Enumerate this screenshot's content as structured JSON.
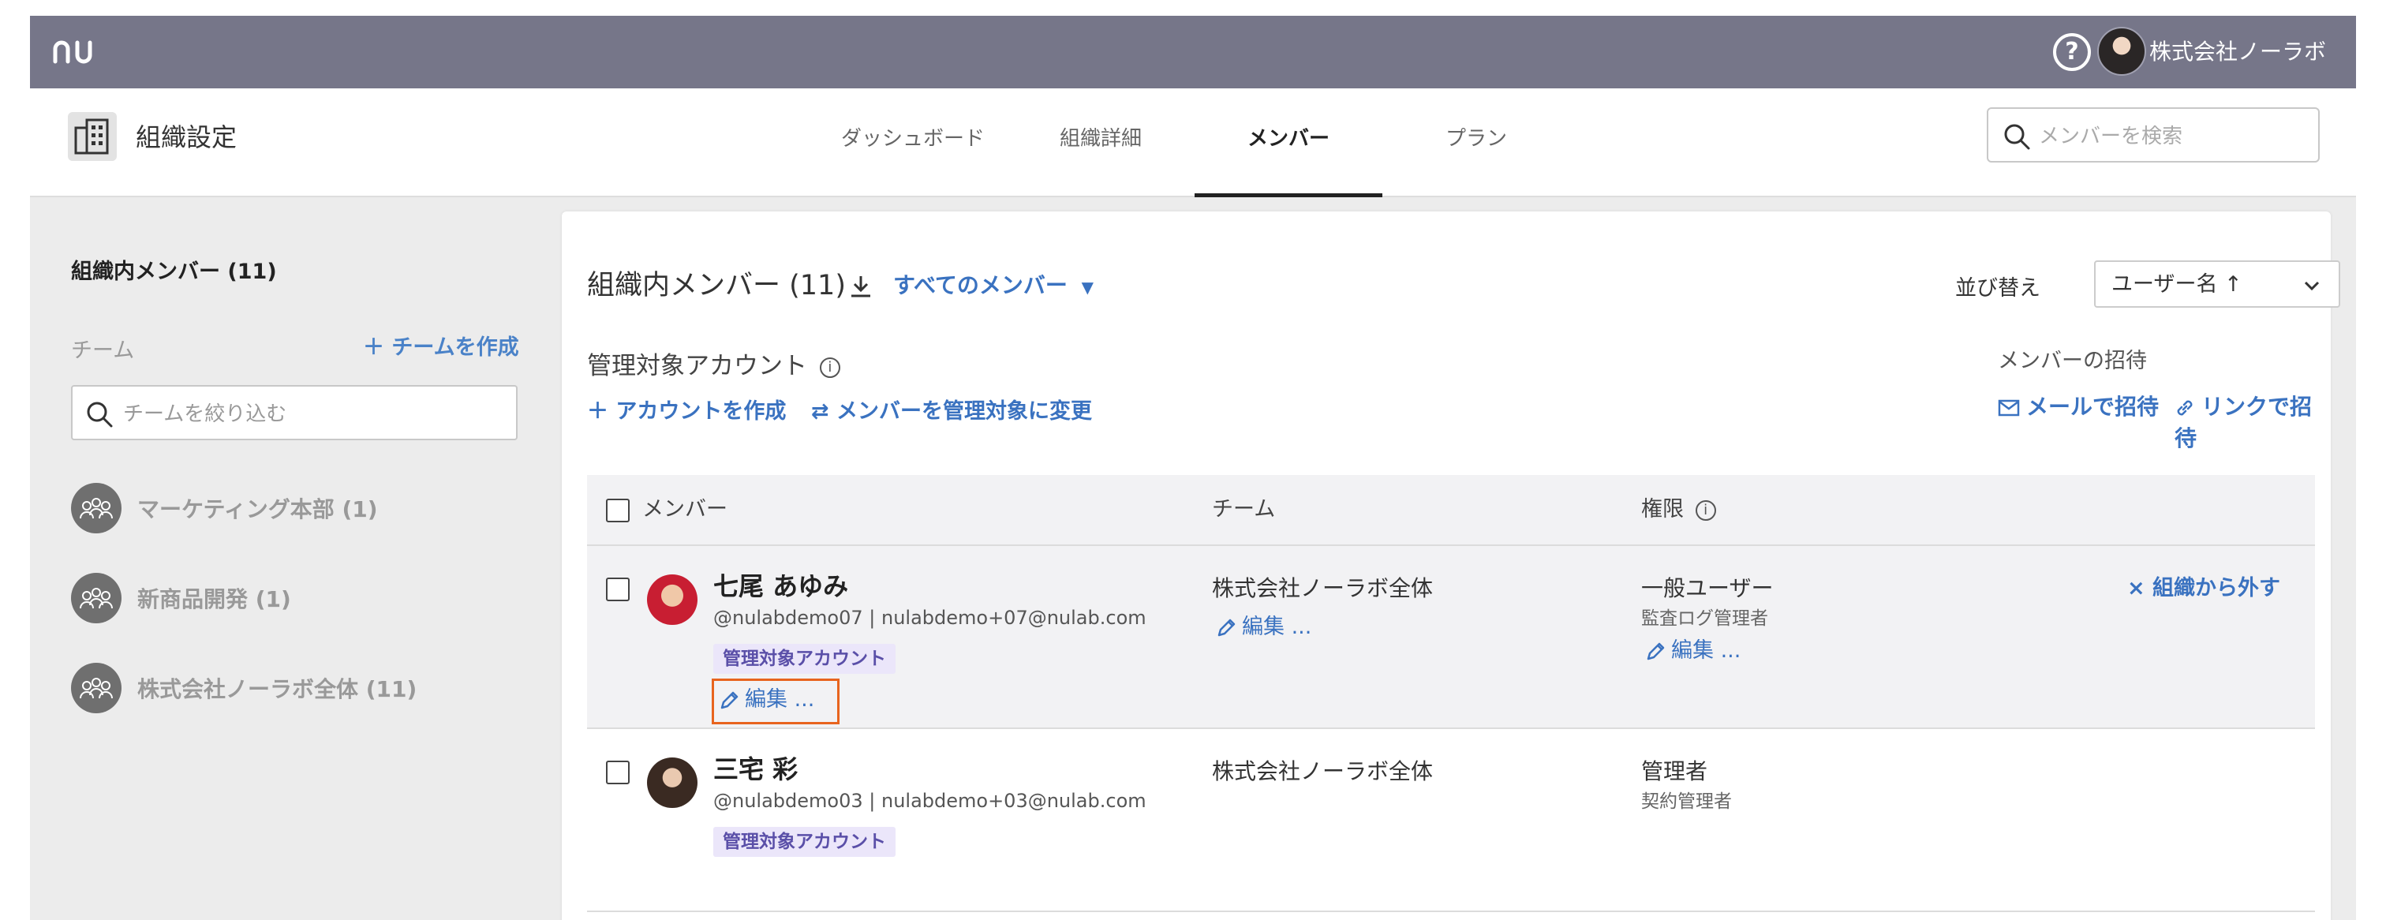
{
  "topbar": {
    "org_name": "株式会社ノーラボ"
  },
  "header": {
    "title": "組織設定",
    "tabs": [
      {
        "label": "ダッシュボード",
        "active": false
      },
      {
        "label": "組織詳細",
        "active": false
      },
      {
        "label": "メンバー",
        "active": true
      },
      {
        "label": "プラン",
        "active": false
      }
    ],
    "search_placeholder": "メンバーを検索"
  },
  "sidebar": {
    "title": "組織内メンバー (11)",
    "team_label": "チーム",
    "create_team_label": "＋ チームを作成",
    "filter_placeholder": "チームを絞り込む",
    "teams": [
      {
        "label": "マーケティング本部 (1)"
      },
      {
        "label": "新商品開発 (1)"
      },
      {
        "label": "株式会社ノーラボ全体 (11)"
      }
    ]
  },
  "main": {
    "title": "組織内メンバー (11)",
    "filter_label": "すべてのメンバー",
    "sort_label": "並び替え",
    "sort_value": "ユーザー名 ↑",
    "managed_label": "管理対象アカウント",
    "create_account_label": "＋ アカウントを作成",
    "change_managed_label": "⇄ メンバーを管理対象に変更",
    "invite_label": "メンバーの招待",
    "invite_mail_label": "メールで招待",
    "invite_link_label": "リンクで招待"
  },
  "table": {
    "headers": {
      "member": "メンバー",
      "team": "チーム",
      "role": "権限"
    },
    "rows": [
      {
        "name": "七尾 あゆみ",
        "handle": "@nulabdemo07 | nulabdemo+07@nulab.com",
        "badge": "管理対象アカウント",
        "edit_label": "編集 ...",
        "team": "株式会社ノーラボ全体",
        "team_edit_label": "編集 ...",
        "role": "一般ユーザー",
        "role_sub": "監査ログ管理者",
        "role_edit_label": "編集 ...",
        "remove_label": "× 組織から外す"
      },
      {
        "name": "三宅 彩",
        "handle": "@nulabdemo03 | nulabdemo+03@nulab.com",
        "badge": "管理対象アカウント",
        "team": "株式会社ノーラボ全体",
        "role": "管理者",
        "role_sub": "契約管理者"
      }
    ]
  },
  "colors": {
    "topbar": "#767689",
    "link": "#3a72c0",
    "badge_bg": "#ebe6fa",
    "badge_text": "#5a4fa8",
    "highlight": "#e8641e"
  },
  "icons": [
    "nulab-logo-icon",
    "help-icon",
    "org-building-icon",
    "search-icon",
    "download-icon",
    "caret-down-icon",
    "chevron-down-icon",
    "info-icon",
    "plus-icon",
    "swap-icon",
    "mail-icon",
    "link-icon",
    "team-people-icon",
    "pencil-icon",
    "close-icon"
  ]
}
